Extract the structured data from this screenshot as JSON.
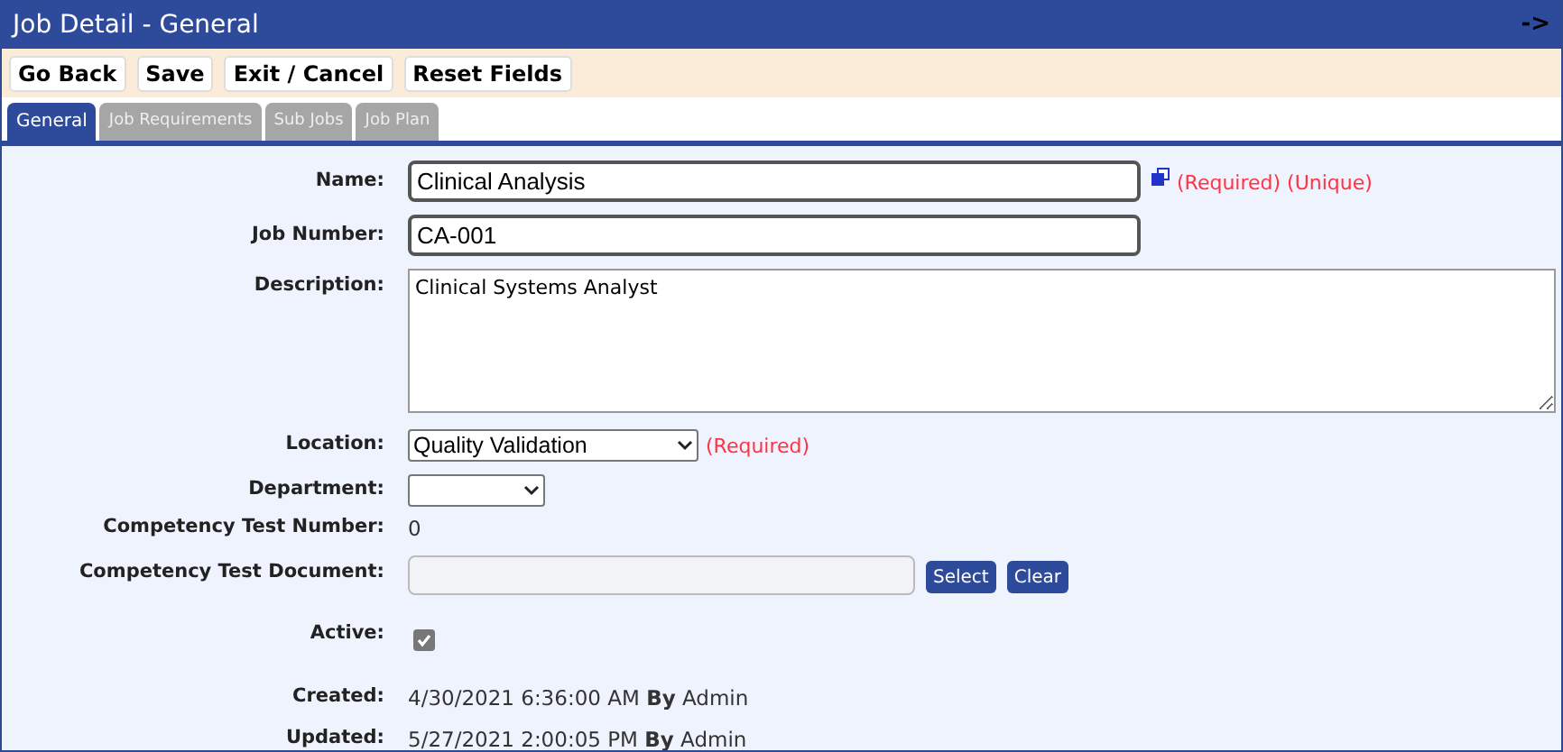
{
  "window": {
    "title": "Job Detail - General",
    "corner_glyph": "->"
  },
  "toolbar": [
    "Go Back",
    "Save",
    "Exit / Cancel",
    "Reset Fields"
  ],
  "tabs": [
    {
      "label": "General",
      "selected": true
    },
    {
      "label": "Job Requirements",
      "selected": false
    },
    {
      "label": "Sub Jobs",
      "selected": false
    },
    {
      "label": "Job Plan",
      "selected": false
    }
  ],
  "fields": [
    {
      "kind": "text",
      "label": "Name:",
      "value": "Clinical Analysis",
      "note": "(Required) (Unique)",
      "copy_icon": true
    },
    {
      "kind": "text",
      "label": "Job Number:",
      "value": "CA-001"
    },
    {
      "kind": "textarea",
      "label": "Description:",
      "value": "Clinical Systems Analyst"
    },
    {
      "kind": "select",
      "label": "Location:",
      "value": "Quality Validation",
      "note": "(Required)"
    },
    {
      "kind": "select",
      "label": "Department:"
    },
    {
      "kind": "value",
      "label": "Competency Test Number:",
      "value": "0"
    },
    {
      "kind": "file",
      "label": "Competency Test Document:",
      "buttons": [
        "Select",
        "Clear"
      ]
    },
    {
      "kind": "checkbox",
      "label": "Active:",
      "checked": true
    },
    {
      "kind": "value",
      "label": "Created:",
      "value": "4/30/2021 6:36:00 AM **By** Admin"
    },
    {
      "kind": "value",
      "label": "Updated:",
      "value": "5/27/2021 2:00:05 PM **By** Admin"
    }
  ]
}
